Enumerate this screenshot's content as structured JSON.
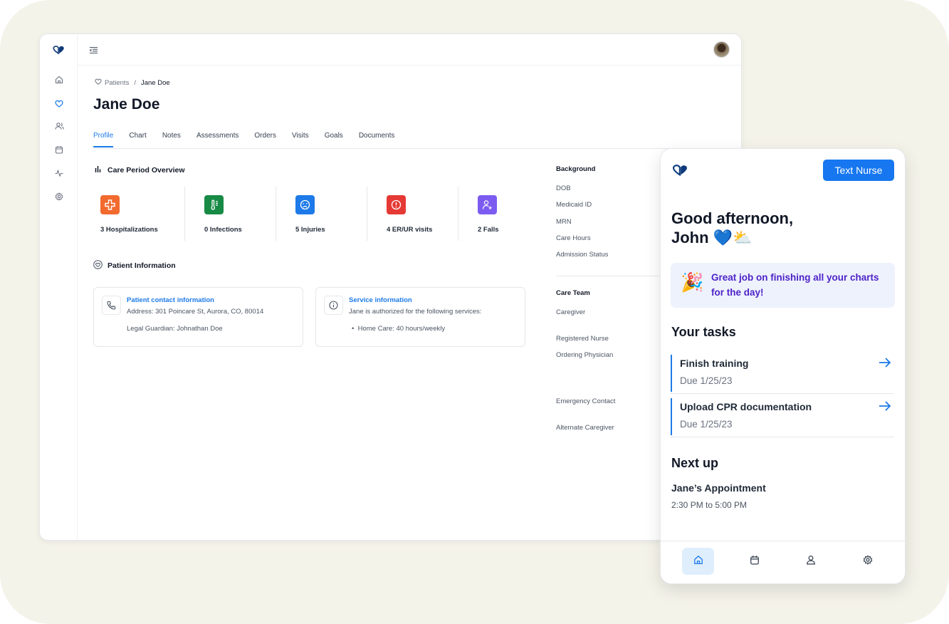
{
  "desktop": {
    "breadcrumb": {
      "parent": "Patients",
      "separator": "/",
      "current": "Jane Doe"
    },
    "title": "Jane Doe",
    "tabs": [
      "Profile",
      "Chart",
      "Notes",
      "Assessments",
      "Orders",
      "Visits",
      "Goals",
      "Documents"
    ],
    "active_tab": "Profile",
    "care_period": {
      "title": "Care Period Overview",
      "stats": [
        {
          "label": "3 Hospitalizations",
          "color": "#f26a2e",
          "icon": "plus-cross-icon"
        },
        {
          "label": "0 Infections",
          "color": "#178a45",
          "icon": "thermometer-icon"
        },
        {
          "label": "5 Injuries",
          "color": "#1d7ae8",
          "icon": "sad-face-icon"
        },
        {
          "label": "4 ER/UR visits",
          "color": "#e53935",
          "icon": "alert-circle-icon"
        },
        {
          "label": "2 Falls",
          "color": "#7c5cf0",
          "icon": "user-plus-icon"
        }
      ]
    },
    "patient_info": {
      "title": "Patient Information",
      "contact": {
        "title": "Patient contact information",
        "address": "Address: 301 Poincare St, Aurora, CO, 80014",
        "guardian": "Legal Guardian: Johnathan Doe"
      },
      "service": {
        "title": "Service information",
        "text": "Jane is authorized for the following services:",
        "item": "Home Care: 40 hours/weekly"
      }
    },
    "background": {
      "title": "Background",
      "fields": [
        "DOB",
        "Medicaid ID",
        "MRN",
        "Care Hours",
        "Admission Status"
      ]
    },
    "care_team": {
      "title": "Care Team",
      "fields": [
        "Caregiver",
        "Registered Nurse",
        "Ordering Physician",
        "Emergency Contact",
        "Alternate Caregiver"
      ]
    }
  },
  "mobile": {
    "text_nurse": "Text Nurse",
    "greeting_line1": "Good afternoon,",
    "greeting_line2": "John 💙⛅",
    "banner_emoji": "🎉",
    "banner": "Great job on finishing all your charts for the day!",
    "tasks_title": "Your tasks",
    "tasks": [
      {
        "title": "Finish training",
        "due": "Due 1/25/23"
      },
      {
        "title": "Upload CPR documentation",
        "due": "Due 1/25/23"
      }
    ],
    "next_title": "Next up",
    "appointment": {
      "title": "Jane’s Appointment",
      "time": "2:30 PM to 5:00 PM"
    },
    "nav": [
      "home-icon",
      "calendar-icon",
      "user-icon",
      "settings-icon"
    ],
    "accent": "#1677f0"
  }
}
